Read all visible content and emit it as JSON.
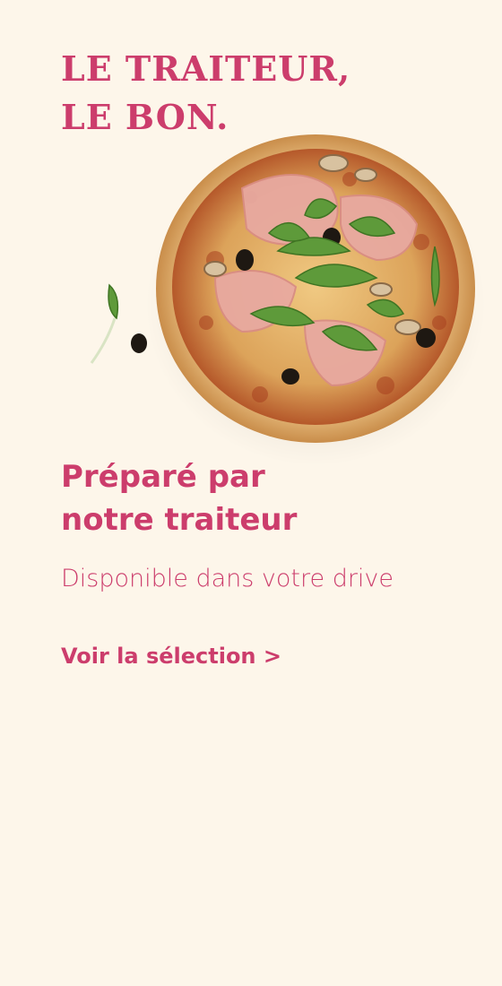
{
  "headline": {
    "line1": "LE TRAITEUR,",
    "line2": "LE BON."
  },
  "visual": {
    "icon": "pizza-image",
    "garnish": "arugula-olive-garnish"
  },
  "promo": {
    "title_line1": "Préparé par",
    "title_line2": "notre traiteur",
    "subtitle": "Disponible dans votre drive",
    "cta": "Voir la sélection >"
  },
  "colors": {
    "brand": "#cc3d6c",
    "background": "#fdf6ea",
    "crust": "#d9a45f",
    "sauce": "#b8502a"
  }
}
